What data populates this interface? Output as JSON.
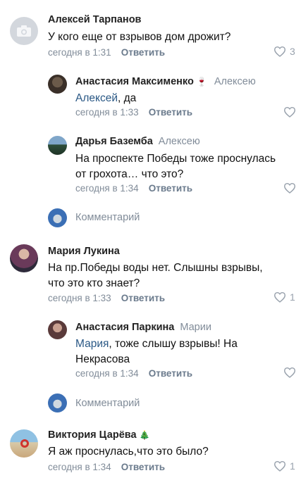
{
  "threads": [
    {
      "author": "Алексей Тарпанов",
      "text": [
        "У кого еще от взрывов дом дрожит?"
      ],
      "time": "сегодня в 1:31",
      "reply_label": "Ответить",
      "likes": "3",
      "replies": [
        {
          "author": "Анастасия Максименко",
          "badge": "🍷",
          "reply_to": "Алексею",
          "mention": "Алексей",
          "text_after_mention": ", да",
          "time": "сегодня в 1:33",
          "reply_label": "Ответить"
        },
        {
          "author": "Дарья Баземба",
          "reply_to": "Алексею",
          "text": [
            "На проспекте Победы тоже проснулась",
            "от грохота… что это?"
          ],
          "time": "сегодня в 1:34",
          "reply_label": "Ответить"
        }
      ],
      "comment_placeholder": "Комментарий"
    },
    {
      "author": "Мария Лукина",
      "text": [
        "На пр.Победы воды нет.  Слышны взрывы,",
        "что это кто знает?"
      ],
      "time": "сегодня в 1:33",
      "reply_label": "Ответить",
      "likes": "1",
      "replies": [
        {
          "author": "Анастасия Паркина",
          "reply_to": "Марии",
          "mention": "Мария",
          "text_after_mention": ", тоже  слышу взрывы! На",
          "text2": "Некрасова",
          "time": "сегодня в 1:34",
          "reply_label": "Ответить"
        }
      ],
      "comment_placeholder": "Комментарий"
    },
    {
      "author": "Виктория Царёва",
      "badge": "🎄",
      "text": [
        "Я аж проснулась,что это было?"
      ],
      "time": "сегодня в 1:34",
      "reply_label": "Ответить",
      "likes": "1"
    }
  ],
  "colors": {
    "link": "#2a5885",
    "secondary": "#818c99",
    "like_icon": "#99a2ad"
  },
  "icons": {
    "like": "heart-icon",
    "camera": "camera-icon"
  }
}
